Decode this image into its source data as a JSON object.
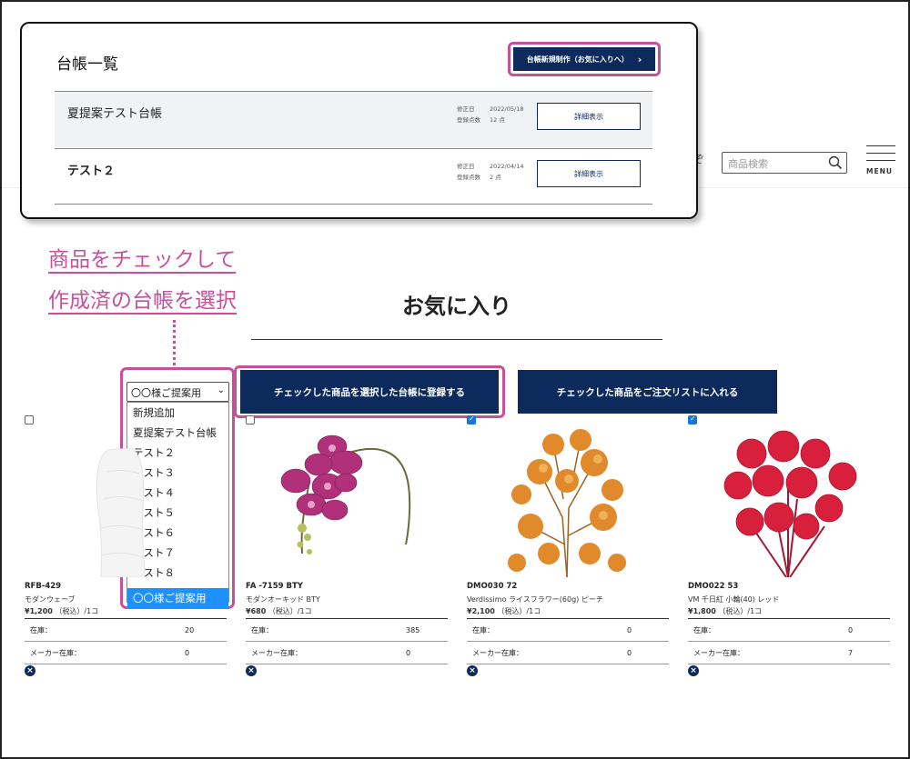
{
  "header": {
    "search_placeholder": "商品検索",
    "menu_label": "MENU",
    "partial_icon": "ぞ"
  },
  "ledger_popup": {
    "title": "台帳一覧",
    "new_button_label": "台帳新規制作（お気に入りへ）",
    "new_button_arrow": "›",
    "rows": [
      {
        "name": "夏提案テスト台帳",
        "modified_label": "修正日",
        "modified_date": "2022/05/18",
        "count_label": "登録点数",
        "count": "12 点",
        "detail_label": "詳細表示"
      },
      {
        "name": "テスト２",
        "modified_label": "修正日",
        "modified_date": "2022/04/14",
        "count_label": "登録点数",
        "count": "2 点",
        "detail_label": "詳細表示"
      }
    ]
  },
  "annotation": {
    "line1": "商品をチェックして",
    "line2": "作成済の台帳を選択"
  },
  "page_title": "お気に入り",
  "ledger_select": {
    "selected": "〇〇様ご提案用",
    "options": [
      "新規追加",
      "夏提案テスト台帳",
      "テスト２",
      "テスト３",
      "テスト４",
      "テスト５",
      "テスト６",
      "テスト７",
      "テスト８"
    ],
    "highlighted_option": "〇〇様ご提案用"
  },
  "actions": {
    "register_label": "チェックした商品を選択した台帳に登録する",
    "order_label": "チェックした商品をご注文リストに入れる"
  },
  "colors": {
    "navy": "#0d2a5c",
    "highlight": "#c8509b",
    "select_blue": "#1e90ff"
  },
  "products": [
    {
      "checked": false,
      "code": "RFB-429",
      "name": "モダンウェーブ",
      "price": "¥1,200",
      "price_suffix": "（税込）/1コ",
      "stock_label": "在庫：",
      "stock": "20",
      "maker_label": "メーカー在庫：",
      "maker_stock": "0",
      "image": "vase"
    },
    {
      "checked": false,
      "code": "FA -7159 BTY",
      "name": "モダンオーキッド BTY",
      "price": "¥680",
      "price_suffix": "（税込）/1コ",
      "stock_label": "在庫：",
      "stock": "385",
      "maker_label": "メーカー在庫：",
      "maker_stock": "0",
      "image": "orchid"
    },
    {
      "checked": true,
      "code": "DMO030 72",
      "name": "Verdissimo ライスフラワー(60g) ピーチ",
      "price": "¥2,100",
      "price_suffix": "（税込）/1コ",
      "stock_label": "在庫：",
      "stock": "0",
      "maker_label": "メーカー在庫：",
      "maker_stock": "0",
      "image": "rice-flower"
    },
    {
      "checked": true,
      "code": "DMO022 53",
      "name": "VM 千日紅 小輪(40) レッド",
      "price": "¥1,800",
      "price_suffix": "（税込）/1コ",
      "stock_label": "在庫：",
      "stock": "0",
      "maker_label": "メーカー在庫：",
      "maker_stock": "7",
      "image": "globe-amaranth"
    }
  ],
  "remove_icon": "×"
}
